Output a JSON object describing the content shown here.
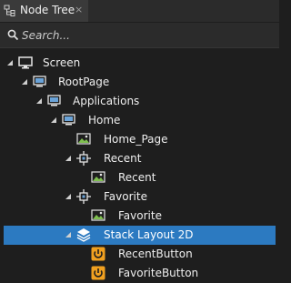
{
  "panel": {
    "tab_title": "Node Tree",
    "close_glyph": "×"
  },
  "search": {
    "placeholder": "Search...",
    "value": ""
  },
  "tree": [
    {
      "label": "Screen",
      "icon": "monitor-icon",
      "expanded": true
    },
    {
      "label": "RootPage",
      "icon": "page-icon",
      "expanded": true
    },
    {
      "label": "Applications",
      "icon": "page-icon",
      "expanded": true
    },
    {
      "label": "Home",
      "icon": "page-icon",
      "expanded": true
    },
    {
      "label": "Home_Page",
      "icon": "image-icon"
    },
    {
      "label": "Recent",
      "icon": "node-icon",
      "expanded": true
    },
    {
      "label": "Recent",
      "icon": "image-icon"
    },
    {
      "label": "Favorite",
      "icon": "node-icon",
      "expanded": true
    },
    {
      "label": "Favorite",
      "icon": "image-icon"
    },
    {
      "label": "Stack Layout 2D",
      "icon": "layers-icon",
      "expanded": true,
      "selected": true
    },
    {
      "label": "RecentButton",
      "icon": "button-icon"
    },
    {
      "label": "FavoriteButton",
      "icon": "button-icon"
    }
  ],
  "colors": {
    "selection": "#2c7ac1",
    "button_icon": "#f0a020",
    "image_icon": "#7fbf4f"
  }
}
